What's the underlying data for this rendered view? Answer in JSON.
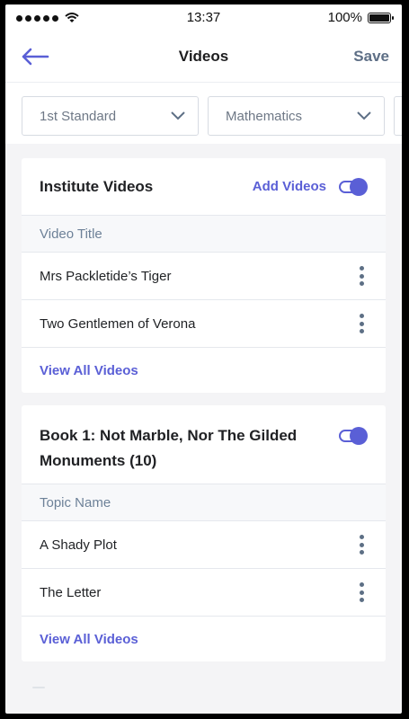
{
  "status_bar": {
    "time": "13:37",
    "battery": "100%"
  },
  "header": {
    "title": "Videos",
    "save_label": "Save"
  },
  "filters": [
    {
      "value": "1st Standard"
    },
    {
      "value": "Mathematics"
    }
  ],
  "institute_card": {
    "title": "Institute Videos",
    "add_label": "Add Videos",
    "column_label": "Video Title",
    "items": [
      {
        "label": "Mrs Packletide’s Tiger"
      },
      {
        "label": "Two Gentlemen of Verona"
      }
    ],
    "view_all": "View All Videos"
  },
  "book_card": {
    "title": "Book 1: Not Marble, Nor The Gilded Monuments (10)",
    "column_label": "Topic Name",
    "items": [
      {
        "label": "A Shady Plot"
      },
      {
        "label": "The Letter"
      }
    ],
    "view_all": "View All Videos"
  },
  "colors": {
    "accent": "#5a5fd6",
    "muted_blue": "#5e6f86"
  }
}
